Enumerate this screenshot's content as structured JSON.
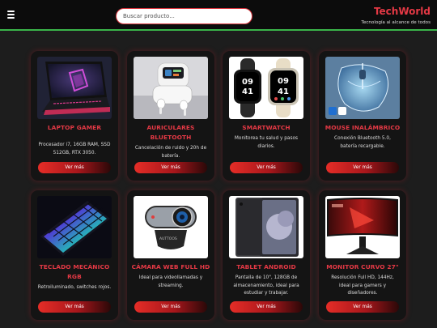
{
  "header": {
    "brand": "TechWorld",
    "tagline": "Tecnología al alcance de todos",
    "search_placeholder": "Buscar producto..."
  },
  "colors": {
    "accent": "#e53945",
    "border_line": "#3ab54a",
    "background": "#1d1d1d"
  },
  "products": [
    {
      "title": "LAPTOP GAMER",
      "description": "Procesador i7, 16GB RAM, SSD 512GB, RTX 3050.",
      "button": "Ver más",
      "icon": "laptop-icon"
    },
    {
      "title": "AURICULARES BLUETOOTH",
      "description": "Cancelación de ruido y 20h de batería.",
      "button": "Ver más",
      "icon": "earbuds-icon"
    },
    {
      "title": "SMARTWATCH",
      "description": "Monitorea tu salud y pasos diarios.",
      "button": "Ver más",
      "icon": "smartwatch-icon"
    },
    {
      "title": "MOUSE INALÁMBRICO",
      "description": "Conexión Bluetooth 5.0, batería recargable.",
      "button": "Ver más",
      "icon": "mouse-icon"
    },
    {
      "title": "TECLADO MECÁNICO RGB",
      "description": "Retroiluminado, switches rojos.",
      "button": "Ver más",
      "icon": "keyboard-icon"
    },
    {
      "title": "CÁMARA WEB FULL HD",
      "description": "Ideal para videollamadas y streaming.",
      "button": "Ver más",
      "icon": "webcam-icon"
    },
    {
      "title": "TABLET ANDROID",
      "description": "Pantalla de 10\", 128GB de almacenamiento, ideal para estudiar y trabajar.",
      "button": "Ver más",
      "icon": "tablet-icon"
    },
    {
      "title": "MONITOR CURVO 27\"",
      "description": "Resolución Full HD, 144Hz, ideal para gamers y diseñadores.",
      "button": "Ver más",
      "icon": "monitor-icon"
    }
  ]
}
